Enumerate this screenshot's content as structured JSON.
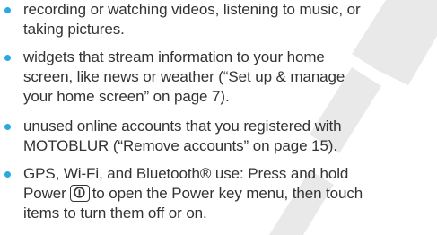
{
  "watermark": {
    "text": "DRAFT",
    "color": "#e9e9e9"
  },
  "accent_color": "#27a9e1",
  "text_color": "#333333",
  "bullets": [
    {
      "lines": [
        "recording or watching videos, listening to music, or",
        "taking pictures."
      ]
    },
    {
      "lines": [
        "widgets that stream information to your home",
        "screen, like news or weather (“Set up & manage",
        "your home screen” on page 7)."
      ]
    },
    {
      "lines": [
        "unused online accounts that you registered with",
        "MOTOBLUR (“Remove accounts” on page 15)."
      ]
    },
    {
      "lines": [
        "GPS, Wi-Fi, and Bluetooth® use: Press and hold",
        "Power",
        "to open the Power key menu, then touch",
        "items to turn them off or on."
      ],
      "icon": "power-key-icon"
    }
  ]
}
